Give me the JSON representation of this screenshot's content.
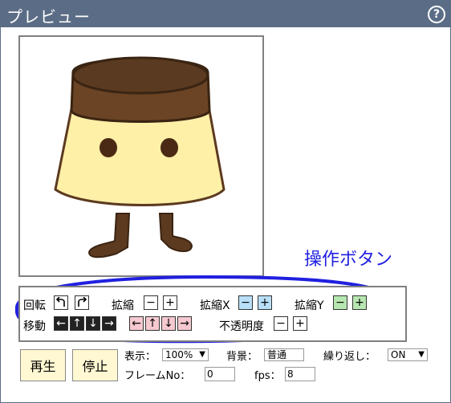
{
  "titlebar": {
    "title": "プレビュー",
    "help_icon": "?"
  },
  "annotation": {
    "label": "操作ボタン",
    "color": "#2020e0"
  },
  "controls": {
    "rotate_label": "回転",
    "scale_label": "拡縮",
    "scalex_label": "拡縮X",
    "scaley_label": "拡縮Y",
    "move_label": "移動",
    "opacity_label": "不透明度"
  },
  "playback": {
    "play_label": "再生",
    "stop_label": "停止",
    "display_label": "表示：",
    "display_value": "100%",
    "background_label": "背景：",
    "background_value": "普通",
    "repeat_label": "繰り返し：",
    "repeat_value": "ON",
    "frameno_label": "フレームNo：",
    "frameno_value": "0",
    "fps_label": "fps：",
    "fps_value": "8"
  },
  "colors": {
    "titlebar": "#5b6d86",
    "pudding_body": "#fff0a8",
    "pudding_caramel": "#5c3a20",
    "button_blue": "#b8dff7",
    "button_green": "#b7e7b1",
    "button_pink": "#f6c9d0",
    "play_button": "#fff8d2"
  }
}
